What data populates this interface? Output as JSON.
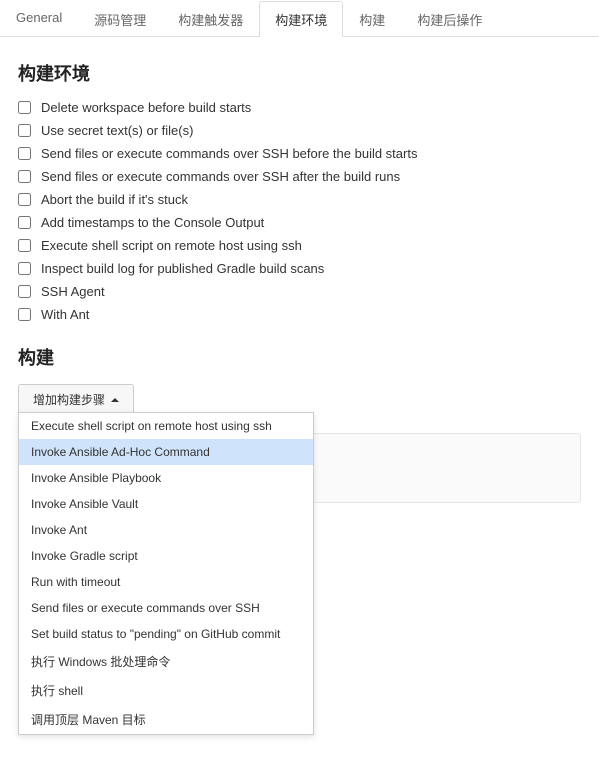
{
  "tabs": [
    {
      "label": "General"
    },
    {
      "label": "源码管理"
    },
    {
      "label": "构建触发器"
    },
    {
      "label": "构建环境"
    },
    {
      "label": "构建"
    },
    {
      "label": "构建后操作"
    }
  ],
  "active_tab_index": 3,
  "env_section": {
    "title": "构建环境",
    "options": [
      "Delete workspace before build starts",
      "Use secret text(s) or file(s)",
      "Send files or execute commands over SSH before the build starts",
      "Send files or execute commands over SSH after the build runs",
      "Abort the build if it's stuck",
      "Add timestamps to the Console Output",
      "Execute shell script on remote host using ssh",
      "Inspect build log for published Gradle build scans",
      "SSH Agent",
      "With Ant"
    ]
  },
  "build_section": {
    "title": "构建",
    "button_label": "增加构建步骤",
    "dropdown_items": [
      "Execute shell script on remote host using ssh",
      "Invoke Ansible Ad-Hoc Command",
      "Invoke Ansible Playbook",
      "Invoke Ansible Vault",
      "Invoke Ant",
      "Invoke Gradle script",
      "Run with timeout",
      "Send files or execute commands over SSH",
      "Set build status to \"pending\" on GitHub commit",
      "执行 Windows 批处理命令",
      "执行 shell",
      "调用顶层 Maven 目标"
    ],
    "highlighted_index": 1
  }
}
